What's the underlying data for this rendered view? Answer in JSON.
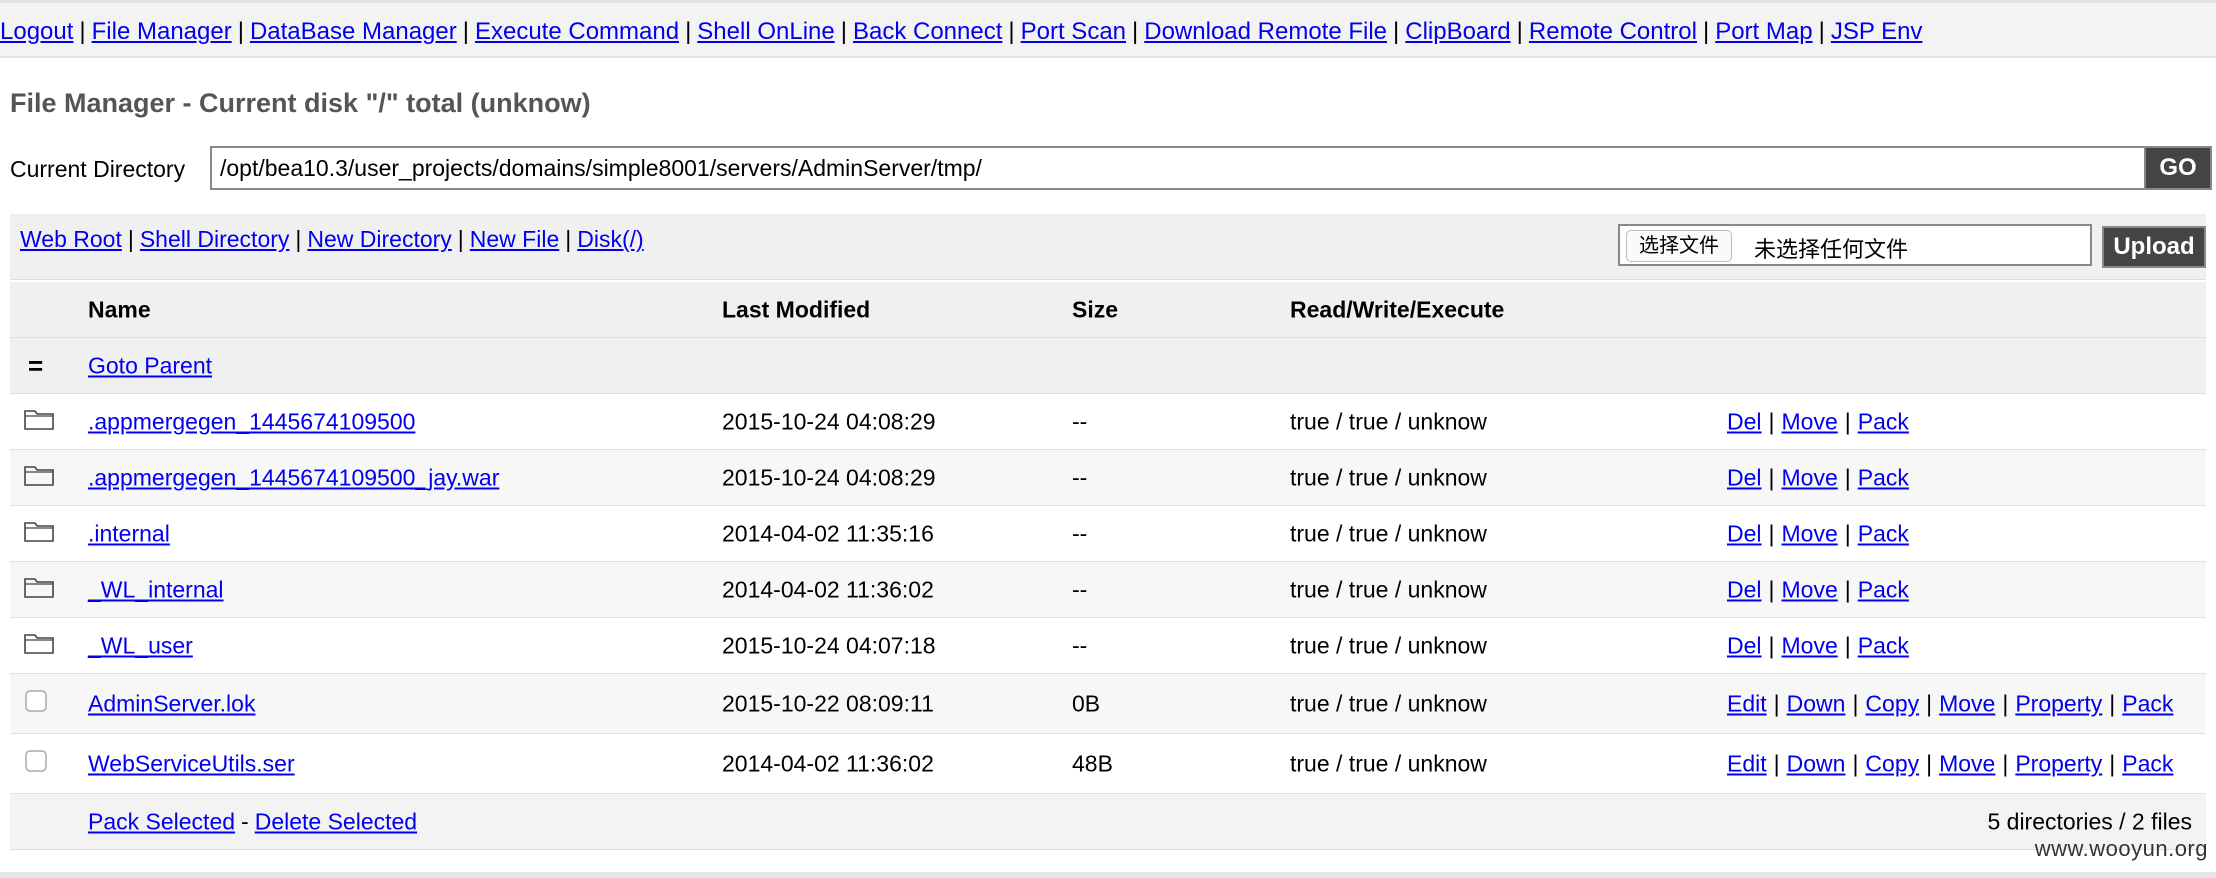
{
  "nav": [
    {
      "label": "Logout"
    },
    {
      "label": "File Manager"
    },
    {
      "label": "DataBase Manager"
    },
    {
      "label": "Execute Command"
    },
    {
      "label": "Shell OnLine"
    },
    {
      "label": "Back Connect"
    },
    {
      "label": "Port Scan"
    },
    {
      "label": "Download Remote File"
    },
    {
      "label": "ClipBoard"
    },
    {
      "label": "Remote Control"
    },
    {
      "label": "Port Map"
    },
    {
      "label": "JSP Env"
    }
  ],
  "page_title": "File Manager - Current disk \"/\" total (unknow)",
  "current_directory": {
    "label": "Current Directory",
    "value": "/opt/bea10.3/user_projects/domains/simple8001/servers/AdminServer/tmp/",
    "go_label": "GO"
  },
  "toolbar": {
    "links": [
      "Web Root",
      "Shell Directory",
      "New Directory",
      "New File",
      "Disk(/)"
    ],
    "choose_file_label": "选择文件",
    "no_file_label": "未选择任何文件",
    "upload_label": "Upload"
  },
  "table": {
    "headers": {
      "name": "Name",
      "modified": "Last Modified",
      "size": "Size",
      "rwx": "Read/Write/Execute"
    },
    "parent": {
      "icon": "=",
      "label": "Goto Parent"
    },
    "directories": [
      {
        "name": ".appmergegen_1445674109500",
        "modified": "2015-10-24 04:08:29",
        "size": "--",
        "rwx": "true / true / unknow",
        "actions": [
          "Del",
          "Move",
          "Pack"
        ]
      },
      {
        "name": ".appmergegen_1445674109500_jay.war",
        "modified": "2015-10-24 04:08:29",
        "size": "--",
        "rwx": "true / true / unknow",
        "actions": [
          "Del",
          "Move",
          "Pack"
        ]
      },
      {
        "name": ".internal",
        "modified": "2014-04-02 11:35:16",
        "size": "--",
        "rwx": "true / true / unknow",
        "actions": [
          "Del",
          "Move",
          "Pack"
        ]
      },
      {
        "name": "_WL_internal",
        "modified": "2014-04-02 11:36:02",
        "size": "--",
        "rwx": "true / true / unknow",
        "actions": [
          "Del",
          "Move",
          "Pack"
        ]
      },
      {
        "name": "_WL_user",
        "modified": "2015-10-24 04:07:18",
        "size": "--",
        "rwx": "true / true / unknow",
        "actions": [
          "Del",
          "Move",
          "Pack"
        ]
      }
    ],
    "files": [
      {
        "name": "AdminServer.lok",
        "modified": "2015-10-22 08:09:11",
        "size": "0B",
        "rwx": "true / true / unknow",
        "actions": [
          "Edit",
          "Down",
          "Copy",
          "Move",
          "Property",
          "Pack"
        ]
      },
      {
        "name": "WebServiceUtils.ser",
        "modified": "2014-04-02 11:36:02",
        "size": "48B",
        "rwx": "true / true / unknow",
        "actions": [
          "Edit",
          "Down",
          "Copy",
          "Move",
          "Property",
          "Pack"
        ]
      }
    ],
    "footer": {
      "pack_selected": "Pack Selected",
      "dash": "-",
      "delete_selected": "Delete Selected",
      "summary": "5 directories / 2 files"
    }
  },
  "watermark": "www.wooyun.org"
}
